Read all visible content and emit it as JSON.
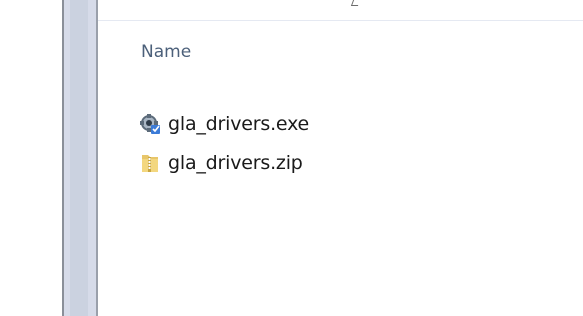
{
  "file_list": {
    "column_header": "Name",
    "files": [
      {
        "name": "gla_drivers.exe",
        "icon": "installer-exe-icon"
      },
      {
        "name": "gla_drivers.zip",
        "icon": "zip-folder-icon"
      }
    ]
  }
}
